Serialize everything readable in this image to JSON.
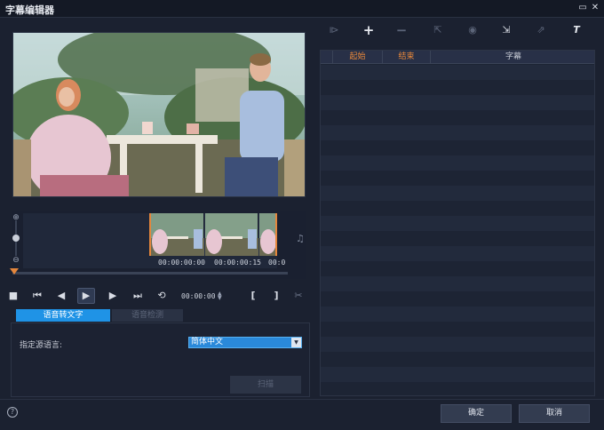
{
  "window": {
    "title": "字幕编辑器",
    "controls": [
      {
        "name": "restore-icon",
        "glyph": "▭"
      },
      {
        "name": "close-icon",
        "glyph": "✕"
      }
    ]
  },
  "timeline": {
    "timecodes": [
      "00:00:00:00",
      "00:00:00:15",
      "00:0"
    ],
    "zoom_in_glyph": "⊕",
    "zoom_out_glyph": "⊖",
    "audio_glyph": "♫"
  },
  "playback": {
    "controls": [
      {
        "name": "stop-icon",
        "glyph": "■"
      },
      {
        "name": "go-to-start-icon",
        "glyph": "⏮"
      },
      {
        "name": "previous-frame-icon",
        "glyph": "◀"
      },
      {
        "name": "play-icon",
        "glyph": "▶"
      },
      {
        "name": "next-frame-icon",
        "glyph": "▶"
      },
      {
        "name": "go-to-end-icon",
        "glyph": "⏭"
      },
      {
        "name": "loop-icon",
        "glyph": "⟲"
      }
    ],
    "timecode": "00:00:00",
    "mark_in_glyph": "[",
    "mark_out_glyph": "]",
    "cut_glyph": "✂"
  },
  "tabs": [
    {
      "label": "语音转文字",
      "active": true
    },
    {
      "label": "语音检测",
      "active": false
    }
  ],
  "speech_to_text": {
    "source_language_label": "指定源语言:",
    "source_language_value": "简体中文",
    "scan_button": "扫描"
  },
  "subtitle_toolbar": [
    {
      "name": "insert-subtitle-icon",
      "glyph": "⧐",
      "enabled": false
    },
    {
      "name": "add-subtitle-icon",
      "glyph": "+",
      "enabled": true
    },
    {
      "name": "remove-subtitle-icon",
      "glyph": "−",
      "enabled": false
    },
    {
      "name": "import-subtitle-icon",
      "glyph": "⇱",
      "enabled": false
    },
    {
      "name": "detect-speech-icon",
      "glyph": "◉",
      "enabled": false
    },
    {
      "name": "merge-subtitle-icon",
      "glyph": "⇲",
      "enabled": true
    },
    {
      "name": "export-subtitle-icon",
      "glyph": "⇗",
      "enabled": false
    },
    {
      "name": "text-style-icon",
      "glyph": "T",
      "enabled": true
    }
  ],
  "subtitle_grid": {
    "columns": [
      "",
      "起始",
      "结束",
      "字幕"
    ],
    "rows": []
  },
  "footer": {
    "help_glyph": "?",
    "ok_label": "确定",
    "cancel_label": "取消"
  },
  "colors": {
    "accent": "#1f93e6",
    "header_orange": "#e8883a",
    "playhead": "#e4863c"
  }
}
